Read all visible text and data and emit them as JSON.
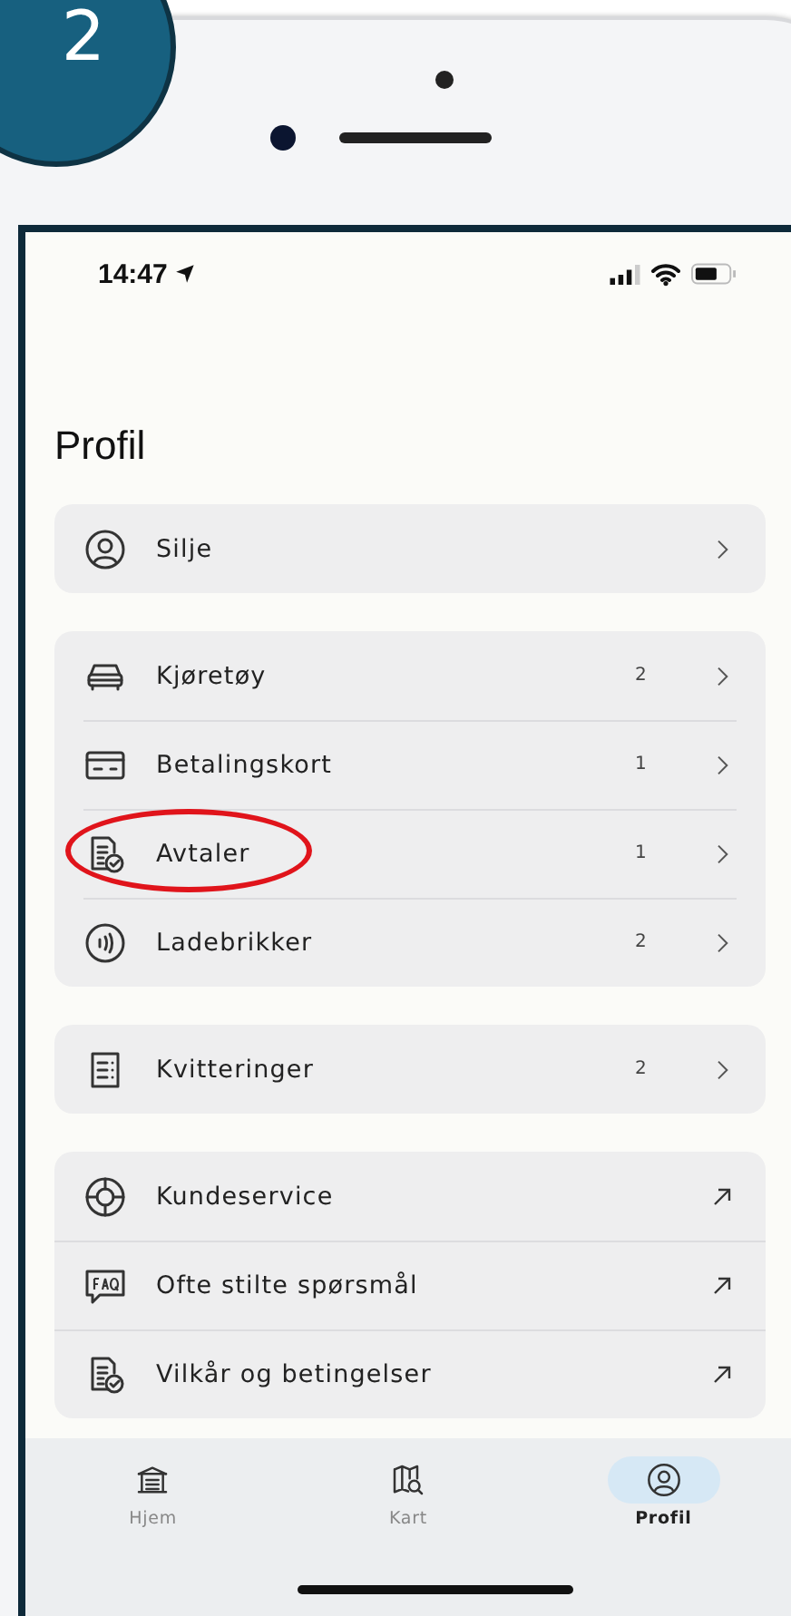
{
  "step_badge": "2",
  "status_bar": {
    "time": "14:47"
  },
  "title": "Profil",
  "groups": [
    {
      "rows": [
        {
          "label": "Silje",
          "kind": "chevron",
          "circled": false
        }
      ]
    },
    {
      "rows": [
        {
          "label": "Kjøretøy",
          "count": "2",
          "kind": "chevron",
          "circled": false
        },
        {
          "label": "Betalingskort",
          "count": "1",
          "kind": "chevron",
          "circled": false
        },
        {
          "label": "Avtaler",
          "count": "1",
          "kind": "chevron",
          "circled": true
        },
        {
          "label": "Ladebrikker",
          "count": "2",
          "kind": "chevron",
          "circled": false
        }
      ]
    },
    {
      "rows": [
        {
          "label": "Kvitteringer",
          "count": "2",
          "kind": "chevron",
          "circled": false
        }
      ]
    },
    {
      "rows": [
        {
          "label": "Kundeservice",
          "kind": "external",
          "circled": false
        },
        {
          "label": "Ofte stilte spørsmål",
          "kind": "external",
          "circled": false
        },
        {
          "label": "Vilkår og betingelser",
          "kind": "external",
          "circled": false
        }
      ]
    }
  ],
  "tabs": [
    {
      "label": "Hjem",
      "selected": false
    },
    {
      "label": "Kart",
      "selected": false
    },
    {
      "label": "Profil",
      "selected": true
    }
  ]
}
